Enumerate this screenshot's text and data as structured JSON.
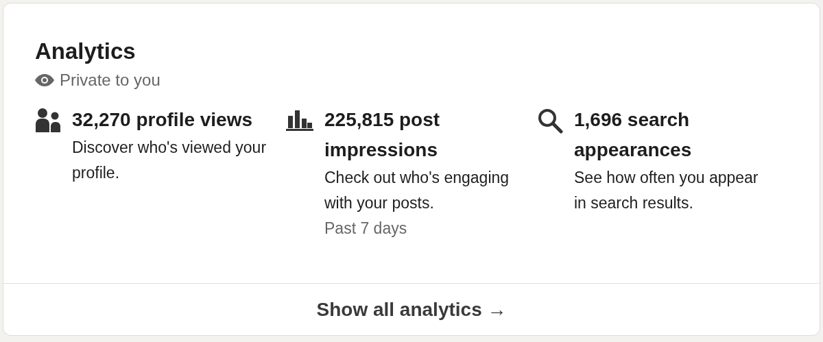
{
  "card": {
    "title": "Analytics",
    "visibility": "Private to you"
  },
  "metrics": [
    {
      "kind": "people",
      "headline": "32,270 profile views",
      "description": "Discover who's viewed your profile."
    },
    {
      "kind": "chart",
      "headline": "225,815 post impressions",
      "description": "Check out who's engaging with your posts.",
      "period": "Past 7 days"
    },
    {
      "kind": "search",
      "headline": "1,696 search appearances",
      "description": "See how often you appear in search results."
    }
  ],
  "footer": {
    "link": "Show all analytics →"
  }
}
